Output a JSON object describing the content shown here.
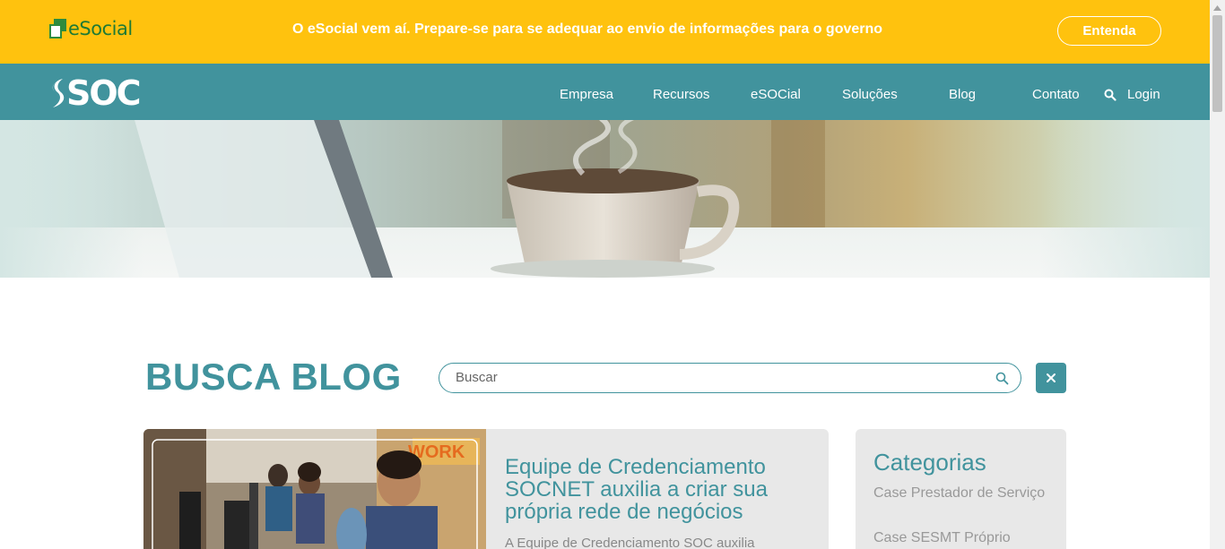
{
  "topbar": {
    "logo_text": "eSocial",
    "message": "O eSocial vem aí. Prepare-se para se adequar ao envio de informações para o governo",
    "cta_label": "Entenda"
  },
  "navbar": {
    "logo_text": "SOC",
    "items": [
      {
        "label": "Empresa"
      },
      {
        "label": "Recursos"
      },
      {
        "label": "eSOCial"
      },
      {
        "label": "Soluções"
      },
      {
        "label": "Blog"
      },
      {
        "label": "Contato"
      }
    ],
    "login_label": "Login"
  },
  "busca": {
    "title": "BUSCA BLOG",
    "search_placeholder": "Buscar"
  },
  "post": {
    "title": "Equipe de Credenciamento SOCNET auxilia a criar sua própria rede de negócios",
    "excerpt": "A Equipe de Credenciamento SOC auxilia",
    "image_sign": "WORK"
  },
  "categories": {
    "title": "Categorias",
    "items": [
      {
        "label": "Case Prestador de Serviço"
      },
      {
        "label": "Case SESMT Próprio"
      }
    ]
  },
  "colors": {
    "yellow": "#ffc20e",
    "teal": "#41939d",
    "card_bg": "#e8e8e8"
  }
}
